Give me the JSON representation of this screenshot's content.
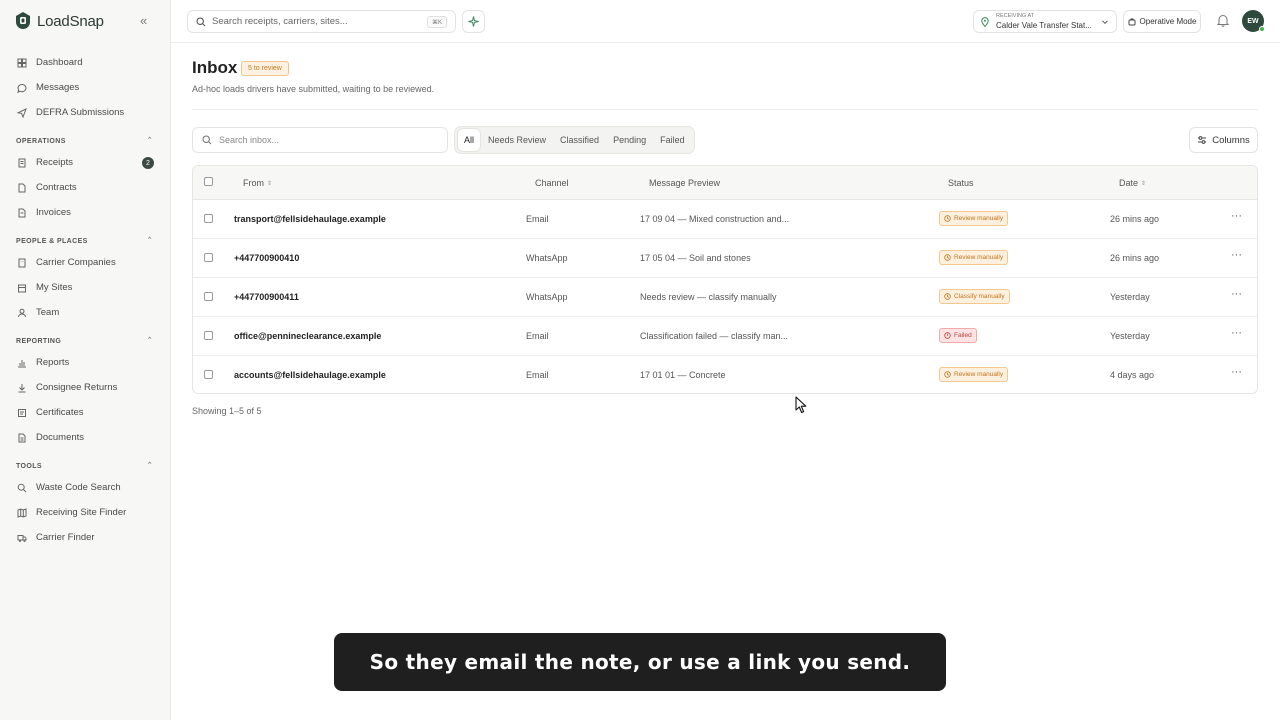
{
  "brand": {
    "name": "LoadSnap"
  },
  "sidebar": {
    "top_items": [
      {
        "label": "Dashboard",
        "icon": "grid-icon"
      },
      {
        "label": "Messages",
        "icon": "chat-icon"
      },
      {
        "label": "DEFRA Submissions",
        "icon": "send-icon"
      }
    ],
    "sections": [
      {
        "title": "OPERATIONS",
        "items": [
          {
            "label": "Receipts",
            "icon": "receipt-icon",
            "badge": "2"
          },
          {
            "label": "Contracts",
            "icon": "file-icon"
          },
          {
            "label": "Invoices",
            "icon": "invoice-icon"
          }
        ]
      },
      {
        "title": "PEOPLE & PLACES",
        "items": [
          {
            "label": "Carrier Companies",
            "icon": "building-icon"
          },
          {
            "label": "My Sites",
            "icon": "site-icon"
          },
          {
            "label": "Team",
            "icon": "user-icon"
          }
        ]
      },
      {
        "title": "REPORTING",
        "items": [
          {
            "label": "Reports",
            "icon": "bar-chart-icon"
          },
          {
            "label": "Consignee Returns",
            "icon": "download-icon"
          },
          {
            "label": "Certificates",
            "icon": "certificate-icon"
          },
          {
            "label": "Documents",
            "icon": "document-icon"
          }
        ]
      },
      {
        "title": "TOOLS",
        "items": [
          {
            "label": "Waste Code Search",
            "icon": "search-icon"
          },
          {
            "label": "Receiving Site Finder",
            "icon": "map-icon"
          },
          {
            "label": "Carrier Finder",
            "icon": "truck-icon"
          }
        ]
      }
    ]
  },
  "topbar": {
    "search_placeholder": "Search receipts, carriers, sites...",
    "shortcut": "⌘K",
    "location_label": "RECEIVING AT",
    "location_name": "Calder Vale Transfer Stat...",
    "mode_label": "Operative Mode",
    "avatar_initials": "EW"
  },
  "page": {
    "title": "Inbox",
    "review_badge": "5 to review",
    "subtitle": "Ad-hoc loads drivers have submitted, waiting to be reviewed.",
    "search_placeholder": "Search inbox...",
    "tabs": [
      "All",
      "Needs Review",
      "Classified",
      "Pending",
      "Failed"
    ],
    "active_tab": "All",
    "columns_label": "Columns",
    "showing": "Showing 1–5 of 5"
  },
  "table": {
    "headers": {
      "from": "From",
      "channel": "Channel",
      "preview": "Message Preview",
      "status": "Status",
      "date": "Date"
    },
    "rows": [
      {
        "from": "transport@fellsidehaulage.example",
        "channel": "Email",
        "preview": "17 09 04 — Mixed construction and...",
        "status": "Review manually",
        "status_type": "warn",
        "date": "26 mins ago"
      },
      {
        "from": "+447700900410",
        "channel": "WhatsApp",
        "preview": "17 05 04 — Soil and stones",
        "status": "Review manually",
        "status_type": "warn",
        "date": "26 mins ago"
      },
      {
        "from": "+447700900411",
        "channel": "WhatsApp",
        "preview": "Needs review — classify manually",
        "status": "Classify manually",
        "status_type": "warn",
        "date": "Yesterday"
      },
      {
        "from": "office@pennineclearance.example",
        "channel": "Email",
        "preview": "Classification failed — classify man...",
        "status": "Failed",
        "status_type": "fail",
        "date": "Yesterday"
      },
      {
        "from": "accounts@fellsidehaulage.example",
        "channel": "Email",
        "preview": "17 01 01 — Concrete",
        "status": "Review manually",
        "status_type": "warn",
        "date": "4 days ago"
      }
    ]
  },
  "caption": {
    "text": "So they email the note, or use a link you send."
  },
  "colors": {
    "accent": "#2e4a3c",
    "warn": "#c2741a",
    "fail": "#c63b3b"
  }
}
